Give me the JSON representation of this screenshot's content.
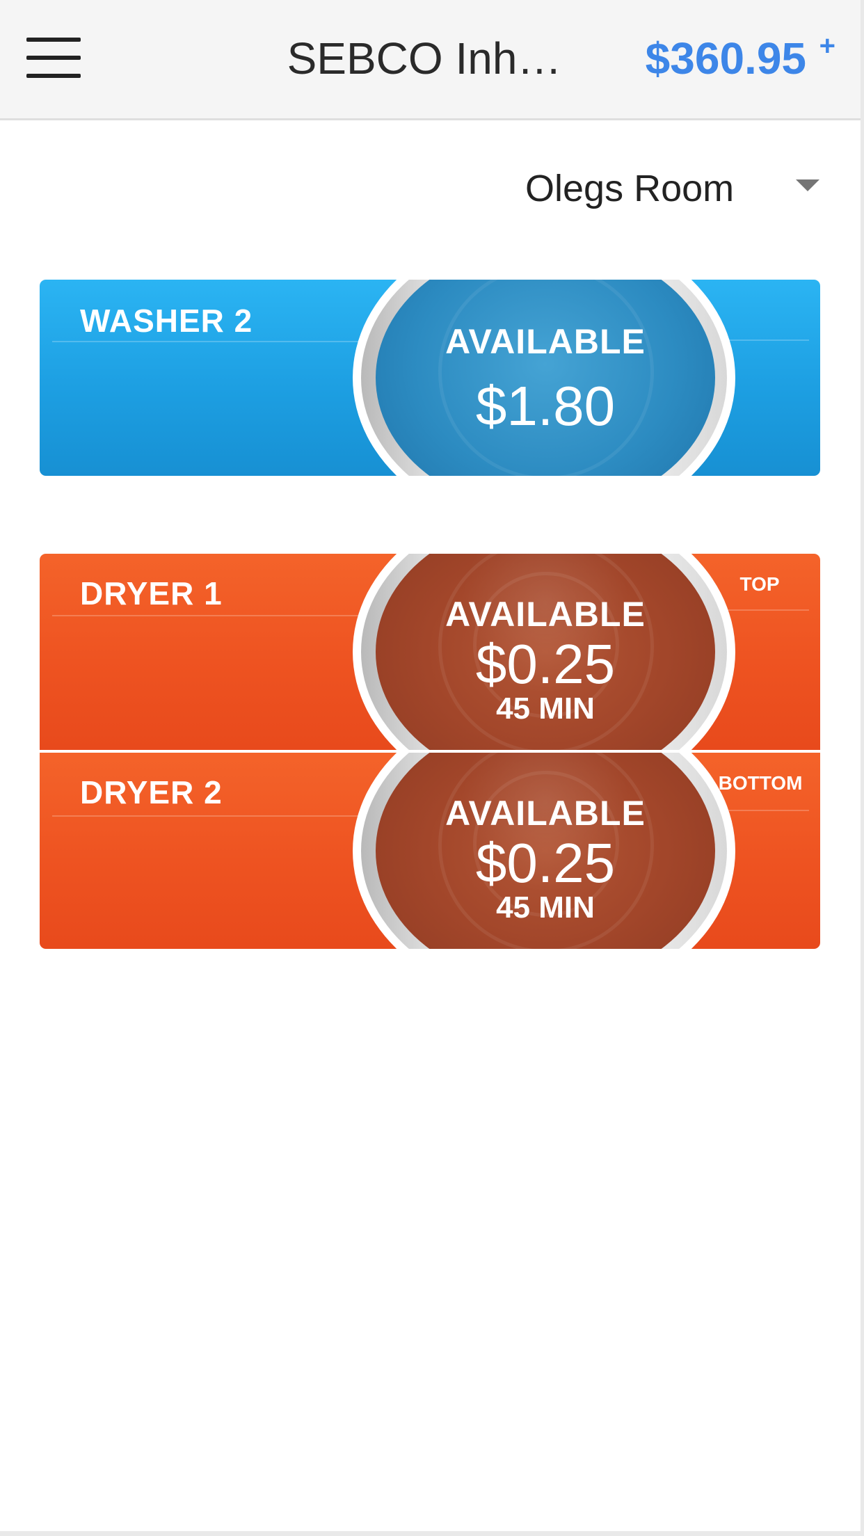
{
  "header": {
    "menu_icon": "hamburger-menu-icon",
    "title": "SEBCO Inh…",
    "balance": "$360.95",
    "add_funds": "+",
    "accent_color": "#3d86e8"
  },
  "room_selector": {
    "selected": "Olegs Room",
    "caret_icon": "dropdown-caret-icon"
  },
  "machines": [
    {
      "name": "WASHER 2",
      "status": "AVAILABLE",
      "price": "$1.80",
      "duration": "",
      "position": "",
      "color": "#1d9fe2"
    },
    {
      "name": "DRYER 1",
      "status": "AVAILABLE",
      "price": "$0.25",
      "duration": "45 MIN",
      "position": "TOP",
      "color": "#ee5321"
    },
    {
      "name": "DRYER 2",
      "status": "AVAILABLE",
      "price": "$0.25",
      "duration": "45 MIN",
      "position": "BOTTOM",
      "color": "#ee5321"
    }
  ]
}
